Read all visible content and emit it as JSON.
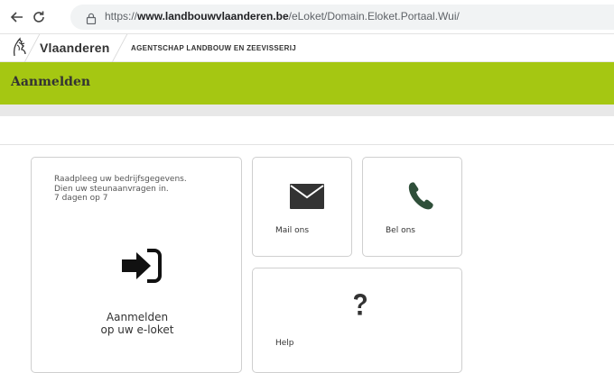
{
  "browser": {
    "url_prefix": "https://",
    "url_domain": "www.landbouwvlaanderen.be",
    "url_path": "/eLoket/Domain.Eloket.Portaal.Wui/"
  },
  "header": {
    "brand": "Vlaanderen",
    "agency": "AGENTSCHAP LANDBOUW EN ZEEVISSERIJ"
  },
  "page": {
    "title": "Aanmelden"
  },
  "tiles": {
    "login": {
      "description": [
        "Raadpleeg uw bedrijfsgegevens.",
        "Dien uw steunaanvragen in.",
        "7 dagen op 7"
      ],
      "label": [
        "Aanmelden",
        "op uw e-loket"
      ],
      "icon": "sign-in-icon"
    },
    "mail": {
      "label": "Mail ons",
      "icon": "envelope-icon"
    },
    "phone": {
      "label": "Bel ons",
      "icon": "phone-icon"
    },
    "help": {
      "label": "Help",
      "icon": "question-mark-icon"
    }
  },
  "colors": {
    "brand_green": "#a5c712",
    "icon_dark": "#333333",
    "phone_green": "#2f4f3a"
  }
}
